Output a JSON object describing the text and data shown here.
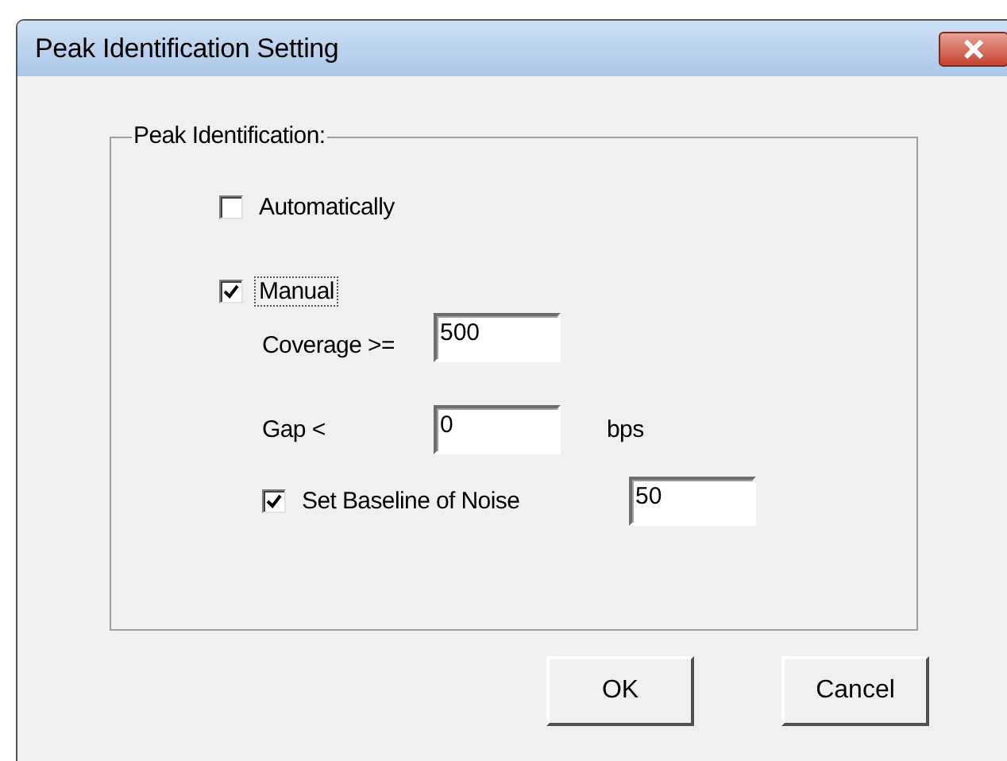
{
  "window": {
    "title": "Peak Identification Setting"
  },
  "group": {
    "label": "Peak Identification:"
  },
  "options": [
    {
      "label": "Automatically",
      "checked": false,
      "focused": false
    },
    {
      "label": "Manual",
      "checked": true,
      "focused": true
    }
  ],
  "manual_settings": {
    "coverage": {
      "label": "Coverage >=",
      "value": "500"
    },
    "gap": {
      "label": "Gap <",
      "value": "0",
      "unit": "bps"
    },
    "baseline": {
      "label": "Set Baseline of Noise",
      "checked": true,
      "value": "50"
    }
  },
  "buttons": [
    "OK",
    "Cancel"
  ]
}
